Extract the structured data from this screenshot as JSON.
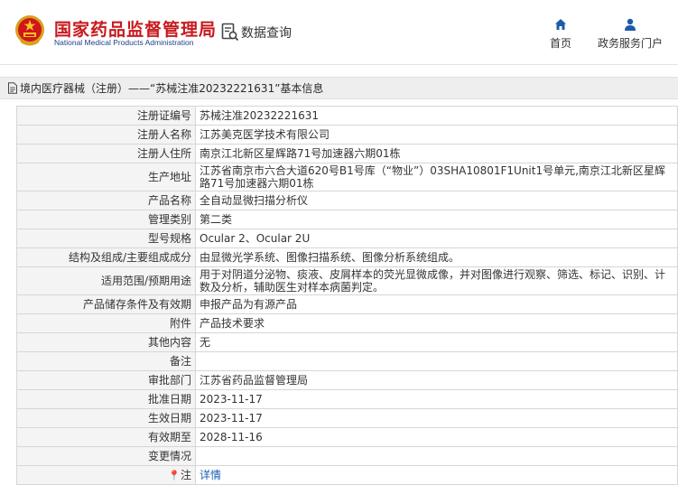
{
  "header": {
    "brand_cn": "国家药品监督管理局",
    "brand_en": "National Medical Products Administration",
    "query_label": "数据查询",
    "nav": [
      {
        "label": "首页",
        "icon": "home-icon"
      },
      {
        "label": "政务服务门户",
        "icon": "user-icon"
      }
    ]
  },
  "breadcrumb": {
    "icon": "document-icon",
    "text": "境内医疗器械（注册）——“苏械注准20232221631”基本信息"
  },
  "detail": {
    "rows": [
      {
        "label": "注册证编号",
        "value": "苏械注准20232221631"
      },
      {
        "label": "注册人名称",
        "value": "江苏美克医学技术有限公司"
      },
      {
        "label": "注册人住所",
        "value": "南京江北新区星辉路71号加速器六期01栋"
      },
      {
        "label": "生产地址",
        "value": "江苏省南京市六合大道620号B1号库（“物业”）03SHA10801F1Unit1号单元,南京江北新区星辉路71号加速器六期01栋"
      },
      {
        "label": "产品名称",
        "value": "全自动显微扫描分析仪"
      },
      {
        "label": "管理类别",
        "value": "第二类"
      },
      {
        "label": "型号规格",
        "value": "Ocular 2、Ocular 2U"
      },
      {
        "label": "结构及组成/主要组成成分",
        "value": "由显微光学系统、图像扫描系统、图像分析系统组成。"
      },
      {
        "label": "适用范围/预期用途",
        "value": "用于对阴道分泌物、痰液、皮屑样本的荧光显微成像，并对图像进行观察、筛选、标记、识别、计数及分析，辅助医生对样本病菌判定。"
      },
      {
        "label": "产品储存条件及有效期",
        "value": "申报产品为有源产品"
      },
      {
        "label": "附件",
        "value": "产品技术要求"
      },
      {
        "label": "其他内容",
        "value": "无"
      },
      {
        "label": "备注",
        "value": ""
      },
      {
        "label": "审批部门",
        "value": "江苏省药品监督管理局"
      },
      {
        "label": "批准日期",
        "value": "2023-11-17"
      },
      {
        "label": "生效日期",
        "value": "2023-11-17"
      },
      {
        "label": "有效期至",
        "value": "2028-11-16"
      },
      {
        "label": "变更情况",
        "value": ""
      },
      {
        "label": "注",
        "value": "详情",
        "icon": "location-pin-icon"
      }
    ]
  }
}
